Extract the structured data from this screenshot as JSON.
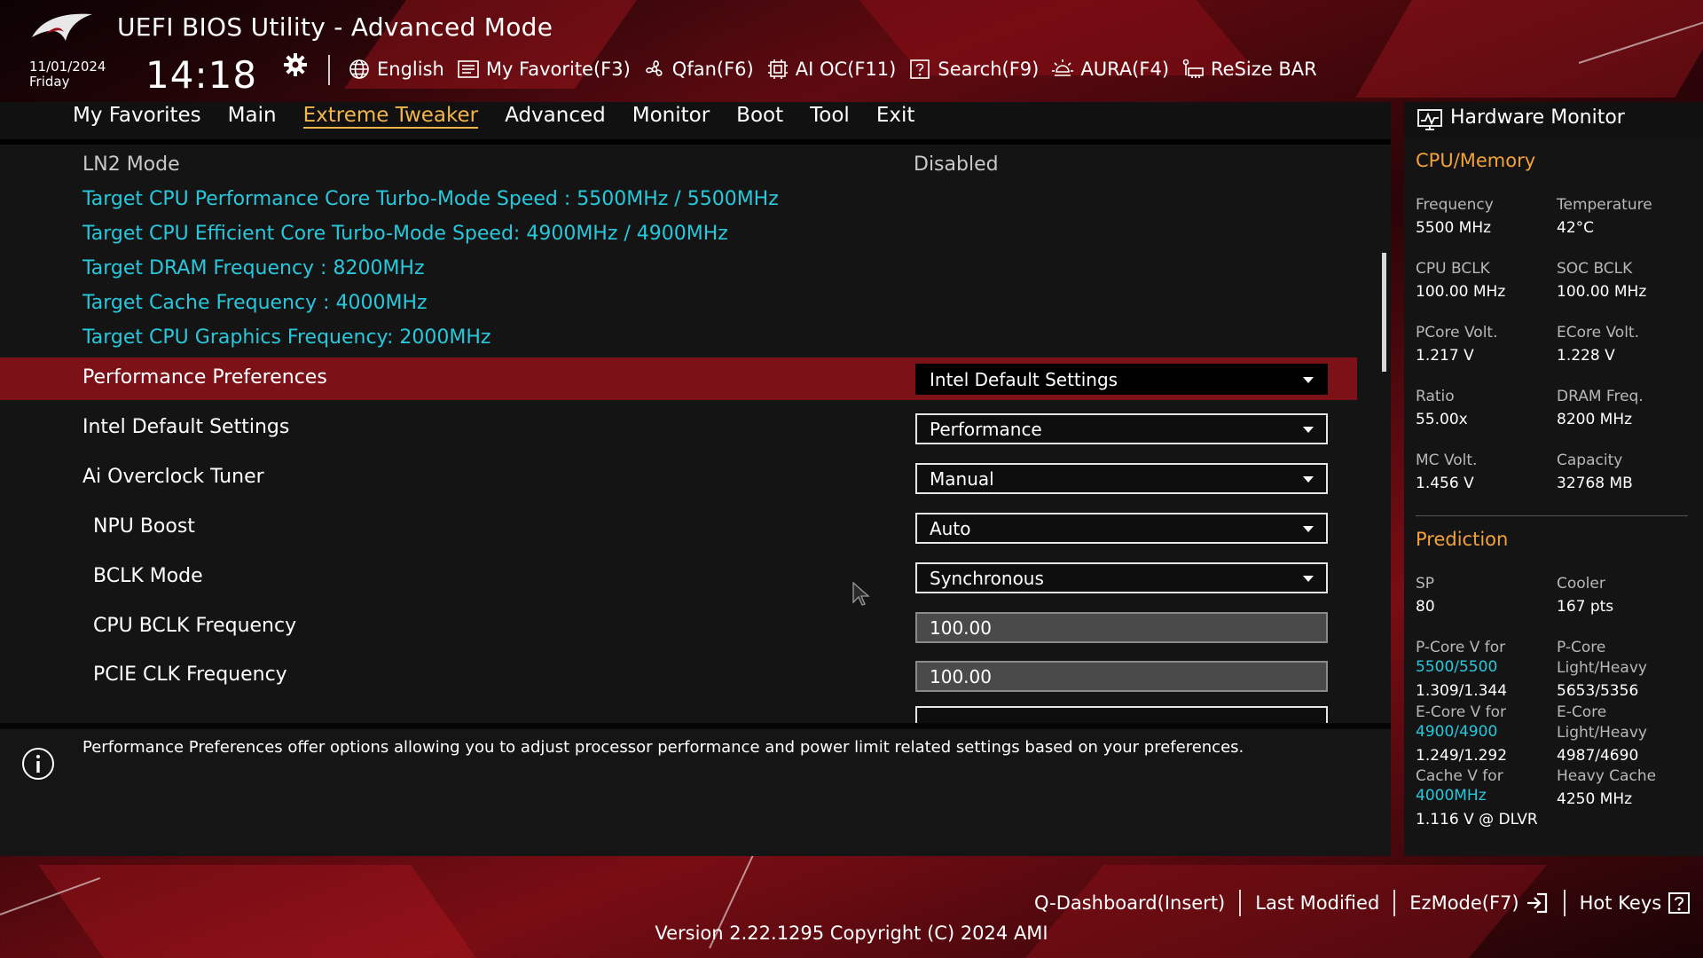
{
  "header": {
    "title": "UEFI BIOS Utility - Advanced Mode",
    "date": "11/01/2024",
    "day": "Friday",
    "time": "14:18",
    "toolbar": [
      {
        "label": "English",
        "icon": "globe-icon"
      },
      {
        "label": "My Favorite(F3)",
        "icon": "favorite-list-icon"
      },
      {
        "label": "Qfan(F6)",
        "icon": "fan-icon"
      },
      {
        "label": "AI OC(F11)",
        "icon": "ai-chip-icon"
      },
      {
        "label": "Search(F9)",
        "icon": "search-question-icon"
      },
      {
        "label": "AURA(F4)",
        "icon": "aura-light-icon"
      },
      {
        "label": "ReSize BAR",
        "icon": "resize-bar-icon"
      }
    ]
  },
  "menu": {
    "tabs": [
      "My Favorites",
      "Main",
      "Extreme Tweaker",
      "Advanced",
      "Monitor",
      "Boot",
      "Tool",
      "Exit"
    ],
    "active": "Extreme Tweaker"
  },
  "settings": {
    "ln2_mode": {
      "label": "LN2 Mode",
      "value": "Disabled"
    },
    "info_lines": [
      "Target CPU Performance Core Turbo-Mode Speed : 5500MHz / 5500MHz",
      "Target CPU Efficient Core Turbo-Mode Speed: 4900MHz / 4900MHz",
      "Target DRAM Frequency : 8200MHz",
      "Target Cache Frequency : 4000MHz",
      "Target CPU Graphics Frequency: 2000MHz"
    ],
    "items": [
      {
        "label": "Performance Preferences",
        "value": "Intel Default Settings",
        "kind": "dropdown"
      },
      {
        "label": "Intel Default Settings",
        "value": "Performance",
        "kind": "dropdown"
      },
      {
        "label": "Ai Overclock Tuner",
        "value": "Manual",
        "kind": "dropdown"
      },
      {
        "label": "NPU Boost",
        "value": "Auto",
        "kind": "dropdown"
      },
      {
        "label": "BCLK Mode",
        "value": "Synchronous",
        "kind": "dropdown"
      },
      {
        "label": "CPU BCLK Frequency",
        "value": "100.00",
        "kind": "number"
      },
      {
        "label": "PCIE CLK Frequency",
        "value": "100.00",
        "kind": "number"
      }
    ]
  },
  "help": {
    "text": "Performance Preferences offer options allowing you to adjust processor performance and power limit related settings based on your preferences."
  },
  "hardware_monitor": {
    "title": "Hardware Monitor",
    "cpu_memory": {
      "heading": "CPU/Memory",
      "frequency_label": "Frequency",
      "frequency": "5500 MHz",
      "temperature_label": "Temperature",
      "temperature": "42°C",
      "cpu_bclk_label": "CPU BCLK",
      "cpu_bclk": "100.00 MHz",
      "soc_bclk_label": "SOC BCLK",
      "soc_bclk": "100.00 MHz",
      "pcore_volt_label": "PCore Volt.",
      "pcore_volt": "1.217 V",
      "ecore_volt_label": "ECore Volt.",
      "ecore_volt": "1.228 V",
      "ratio_label": "Ratio",
      "ratio": "55.00x",
      "dram_freq_label": "DRAM Freq.",
      "dram_freq": "8200 MHz",
      "mc_volt_label": "MC Volt.",
      "mc_volt": "1.456 V",
      "capacity_label": "Capacity",
      "capacity": "32768 MB"
    },
    "prediction": {
      "heading": "Prediction",
      "sp_label": "SP",
      "sp": "80",
      "cooler_label": "Cooler",
      "cooler": "167 pts",
      "pcore_v_label": "P-Core V for",
      "pcore_v_freq": "5500/5500",
      "pcore_v": "1.309/1.344",
      "pcore_lh_label": "P-Core Light/Heavy",
      "pcore_lh": "5653/5356",
      "ecore_v_label": "E-Core V for",
      "ecore_v_freq": "4900/4900",
      "ecore_v": "1.249/1.292",
      "ecore_lh_label": "E-Core Light/Heavy",
      "ecore_lh": "4987/4690",
      "cache_v_label": "Cache V for",
      "cache_v_freq": "4000MHz",
      "cache_v": "1.116 V @ DLVR",
      "heavy_cache_label": "Heavy Cache",
      "heavy_cache": "4250 MHz"
    }
  },
  "footer": {
    "actions": [
      "Q-Dashboard(Insert)",
      "Last Modified",
      "EzMode(F7)",
      "Hot Keys"
    ],
    "version": "Version 2.22.1295 Copyright (C) 2024 AMI"
  },
  "colors": {
    "accent": "#f3b54a",
    "section_orange": "#f3a23a",
    "info_cyan": "#28c8dc",
    "selected_row": "#7c1218"
  }
}
